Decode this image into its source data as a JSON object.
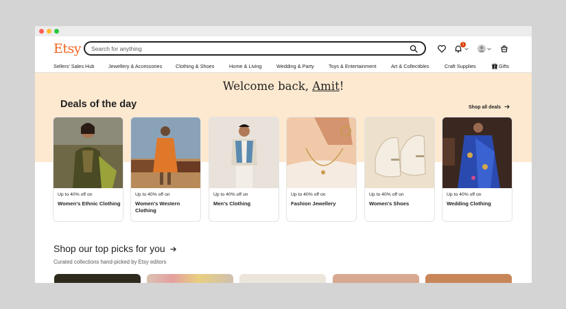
{
  "header": {
    "logo": "Etsy",
    "search_placeholder": "Search for anything",
    "notification_count": "1"
  },
  "nav": {
    "items": [
      "Sellers' Sales Hub",
      "Jewellery & Accessories",
      "Clothing & Shoes",
      "Home & Living",
      "Wedding & Party",
      "Toys & Entertainment",
      "Art & Collectibles",
      "Craft Supplies",
      "Gifts"
    ]
  },
  "hero": {
    "welcome_prefix": "Welcome back, ",
    "user_name": "Amit",
    "welcome_suffix": "!",
    "deals_title": "Deals of the day",
    "shop_all": "Shop all deals"
  },
  "deals": [
    {
      "offer": "Up to 40% off on",
      "name": "Women's Ethnic Clothing"
    },
    {
      "offer": "Up to 40% off on",
      "name": "Women's Western Clothing"
    },
    {
      "offer": "Up to 40% off on",
      "name": "Men's Clothing"
    },
    {
      "offer": "Up to 40% off on",
      "name": "Fashion Jewellery"
    },
    {
      "offer": "Up to 40% off on",
      "name": "Women's Shoes"
    },
    {
      "offer": "Up to 40% off on",
      "name": "Wedding Clothing"
    }
  ],
  "picks": {
    "title": "Shop our top picks for you",
    "subtitle": "Curated collections hand-picked by Etsy editors"
  },
  "colors": {
    "brand": "#f1641e",
    "hero_bg": "#fde9d0",
    "badge": "#d93c00"
  },
  "icons": [
    "search-icon",
    "heart-icon",
    "bell-icon",
    "avatar",
    "cart-icon",
    "gift-icon",
    "arrow-right-icon"
  ]
}
